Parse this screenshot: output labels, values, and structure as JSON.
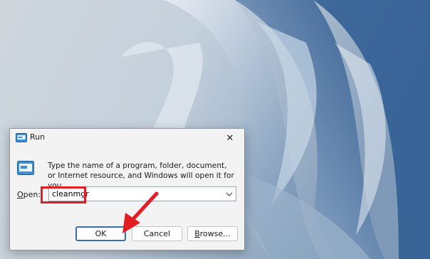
{
  "window": {
    "title": "Run",
    "close_glyph": "✕",
    "icon": "run-app-icon"
  },
  "description": "Type the name of a program, folder, document, or Internet resource, and Windows will open it for you.",
  "open_field": {
    "label_underlined": "O",
    "label_rest": "pen:",
    "value": "cleanmgr",
    "dropdown_icon": "chevron-down-icon"
  },
  "buttons": {
    "ok": "OK",
    "cancel": "Cancel",
    "browse_underlined": "B",
    "browse_rest": "rowse..."
  },
  "colors": {
    "highlight": "#e21d24",
    "wallpaper": "#b9c8d6"
  }
}
